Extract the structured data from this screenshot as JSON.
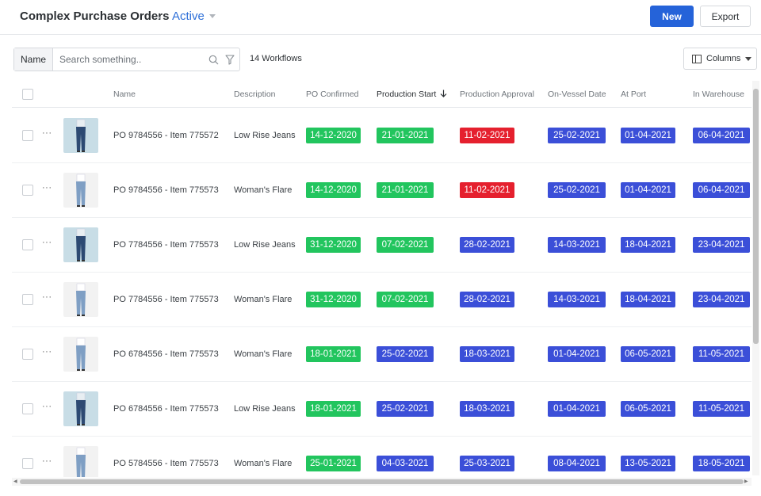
{
  "header": {
    "title": "Complex Purchase Orders",
    "separator": "›",
    "view_name": "Active",
    "new_label": "New",
    "export_label": "Export"
  },
  "toolbar": {
    "filter_field": "Name",
    "search_placeholder": "Search something..",
    "workflow_count": "14 Workflows",
    "columns_label": "Columns"
  },
  "table": {
    "columns": [
      "Name",
      "Description",
      "PO Confirmed",
      "Production Start",
      "Production Approval",
      "On-Vessel Date",
      "At Port",
      "In Warehouse"
    ],
    "sorted_column": "Production Start",
    "sort_icon": "arrow-down-icon",
    "rows": [
      {
        "thumb": "navy",
        "name": "PO 9784556 - Item 775572",
        "description": "Low Rise Jeans",
        "po_confirmed": "14-12-2020",
        "production_start": "21-01-2021",
        "production_approval": "11-02-2021",
        "on_vessel": "25-02-2021",
        "at_port": "01-04-2021",
        "in_warehouse": "06-04-2021",
        "colors": [
          "green",
          "green",
          "red",
          "blue",
          "blue",
          "blue"
        ]
      },
      {
        "thumb": "light",
        "name": "PO 9784556 - Item 775573",
        "description": "Woman's Flare",
        "po_confirmed": "14-12-2020",
        "production_start": "21-01-2021",
        "production_approval": "11-02-2021",
        "on_vessel": "25-02-2021",
        "at_port": "01-04-2021",
        "in_warehouse": "06-04-2021",
        "colors": [
          "green",
          "green",
          "red",
          "blue",
          "blue",
          "blue"
        ]
      },
      {
        "thumb": "navy",
        "name": "PO 7784556 - Item 775573",
        "description": "Low Rise Jeans",
        "po_confirmed": "31-12-2020",
        "production_start": "07-02-2021",
        "production_approval": "28-02-2021",
        "on_vessel": "14-03-2021",
        "at_port": "18-04-2021",
        "in_warehouse": "23-04-2021",
        "colors": [
          "green",
          "green",
          "blue",
          "blue",
          "blue",
          "blue"
        ]
      },
      {
        "thumb": "light",
        "name": "PO 7784556 - Item 775573",
        "description": "Woman's Flare",
        "po_confirmed": "31-12-2020",
        "production_start": "07-02-2021",
        "production_approval": "28-02-2021",
        "on_vessel": "14-03-2021",
        "at_port": "18-04-2021",
        "in_warehouse": "23-04-2021",
        "colors": [
          "green",
          "green",
          "blue",
          "blue",
          "blue",
          "blue"
        ]
      },
      {
        "thumb": "light",
        "name": "PO 6784556 - Item 775573",
        "description": "Woman's Flare",
        "po_confirmed": "18-01-2021",
        "production_start": "25-02-2021",
        "production_approval": "18-03-2021",
        "on_vessel": "01-04-2021",
        "at_port": "06-05-2021",
        "in_warehouse": "11-05-2021",
        "colors": [
          "green",
          "blue",
          "blue",
          "blue",
          "blue",
          "blue"
        ]
      },
      {
        "thumb": "navy",
        "name": "PO 6784556 - Item 775573",
        "description": "Low Rise Jeans",
        "po_confirmed": "18-01-2021",
        "production_start": "25-02-2021",
        "production_approval": "18-03-2021",
        "on_vessel": "01-04-2021",
        "at_port": "06-05-2021",
        "in_warehouse": "11-05-2021",
        "colors": [
          "green",
          "blue",
          "blue",
          "blue",
          "blue",
          "blue"
        ]
      },
      {
        "thumb": "light",
        "name": "PO 5784556 - Item 775573",
        "description": "Woman's Flare",
        "po_confirmed": "25-01-2021",
        "production_start": "04-03-2021",
        "production_approval": "25-03-2021",
        "on_vessel": "08-04-2021",
        "at_port": "13-05-2021",
        "in_warehouse": "18-05-2021",
        "colors": [
          "green",
          "blue",
          "blue",
          "blue",
          "blue",
          "blue"
        ]
      }
    ]
  },
  "status_colors": {
    "green": "#22c55e",
    "red": "#e5202e",
    "blue": "#3b4fd8"
  },
  "accent_color": "#2563d9"
}
